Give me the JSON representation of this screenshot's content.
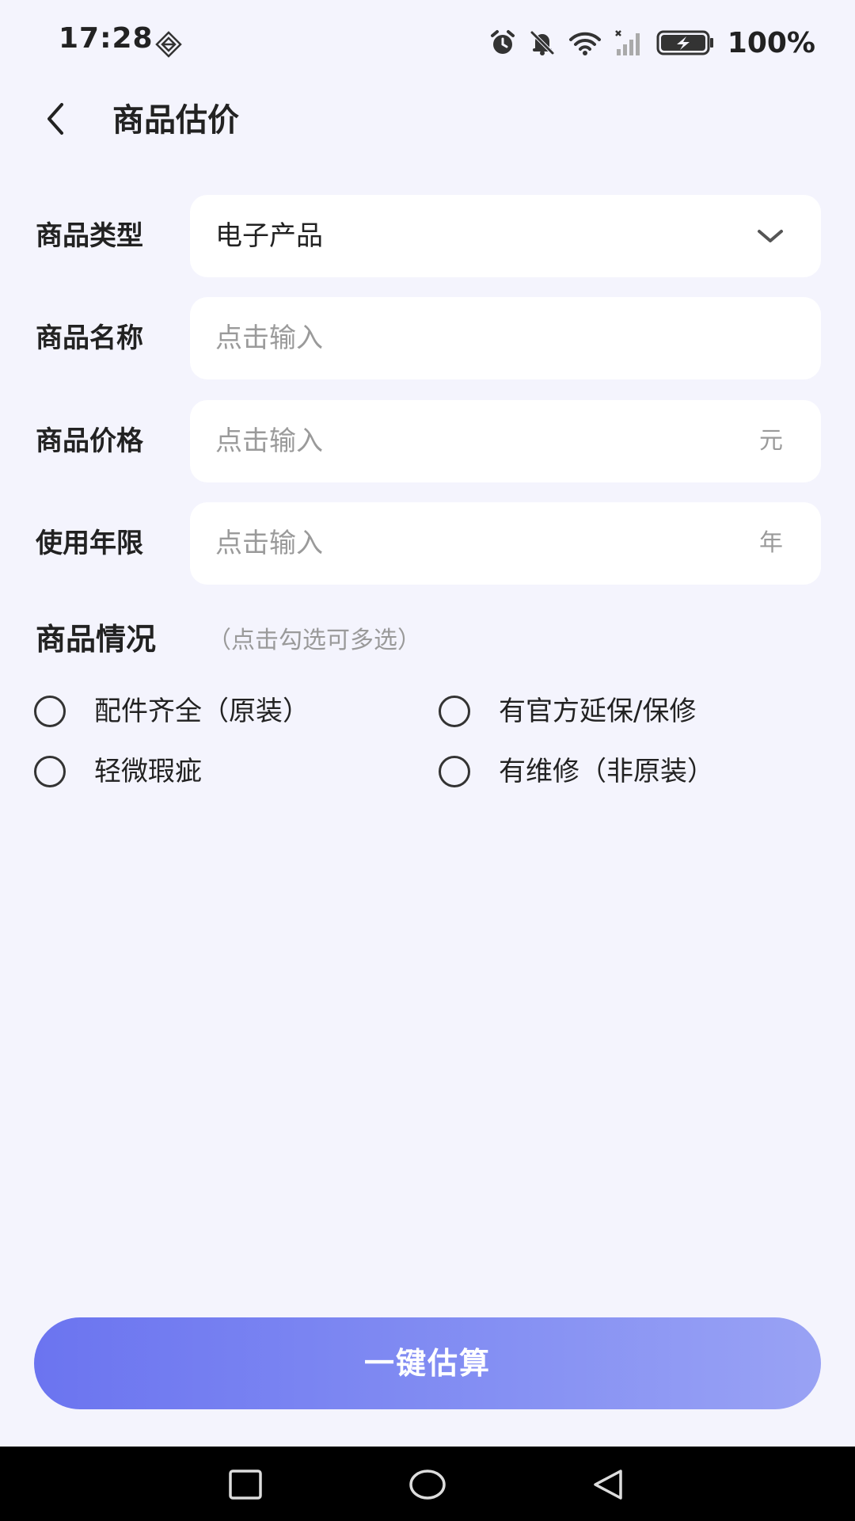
{
  "status_bar": {
    "time": "17:28",
    "battery": "100%"
  },
  "header": {
    "title": "商品估价"
  },
  "form": {
    "category": {
      "label": "商品类型",
      "value": "电子产品"
    },
    "name": {
      "label": "商品名称",
      "placeholder": "点击输入"
    },
    "price": {
      "label": "商品价格",
      "placeholder": "点击输入",
      "unit": "元"
    },
    "years": {
      "label": "使用年限",
      "placeholder": "点击输入",
      "unit": "年"
    }
  },
  "condition": {
    "title": "商品情况",
    "hint": "（点击勾选可多选）",
    "options": [
      {
        "label": "配件齐全（原装）",
        "checked": false
      },
      {
        "label": "有官方延保/保修",
        "checked": false
      },
      {
        "label": "轻微瑕疵",
        "checked": false
      },
      {
        "label": "有维修（非原装）",
        "checked": false
      }
    ]
  },
  "action": {
    "estimate_label": "一键估算"
  },
  "icons": {
    "back": "back-arrow-icon",
    "dropdown": "chevron-down-icon",
    "nav_recent": "square-icon",
    "nav_home": "circle-icon",
    "nav_back": "triangle-back-icon"
  },
  "colors": {
    "background": "#F4F4FD",
    "button_gradient_start": "#6B74F0",
    "button_gradient_end": "#99A2F4"
  }
}
